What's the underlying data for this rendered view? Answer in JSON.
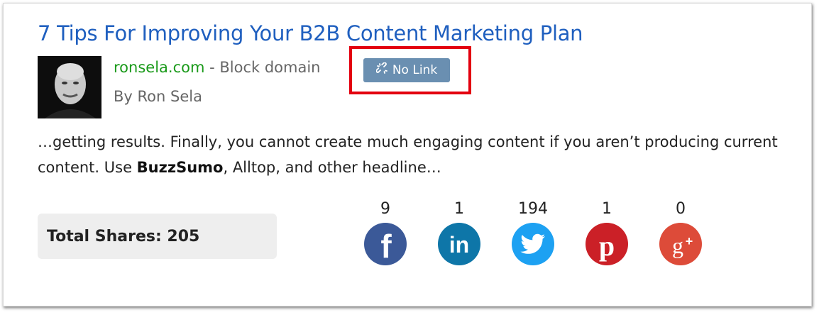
{
  "result": {
    "title": "7 Tips For Improving Your B2B Content Marketing Plan",
    "domain": "ronsela.com",
    "separator": " - ",
    "block_domain_label": "Block domain",
    "no_link_label": "No Link",
    "author": "By Ron Sela",
    "snippet_before": "…getting results. Finally, you cannot create much engaging content if you aren’t producing current content. Use ",
    "snippet_bold": "BuzzSumo",
    "snippet_after": ", Alltop, and other headline…",
    "total_shares_label": "Total Shares: 205"
  },
  "social": [
    {
      "network": "facebook",
      "icon": "facebook-icon",
      "count": "9",
      "color": "#3b5998"
    },
    {
      "network": "linkedin",
      "icon": "linkedin-icon",
      "count": "1",
      "color": "#0e76a8"
    },
    {
      "network": "twitter",
      "icon": "twitter-icon",
      "count": "194",
      "color": "#1da1f2"
    },
    {
      "network": "pinterest",
      "icon": "pinterest-icon",
      "count": "1",
      "color": "#cb2027"
    },
    {
      "network": "googleplus",
      "icon": "google-plus-icon",
      "count": "0",
      "color": "#dd4b39"
    }
  ],
  "colors": {
    "title_link": "#1f5fbf",
    "domain": "#1a9a1a",
    "badge": "#6a8fb1",
    "highlight": "#e3000f"
  }
}
